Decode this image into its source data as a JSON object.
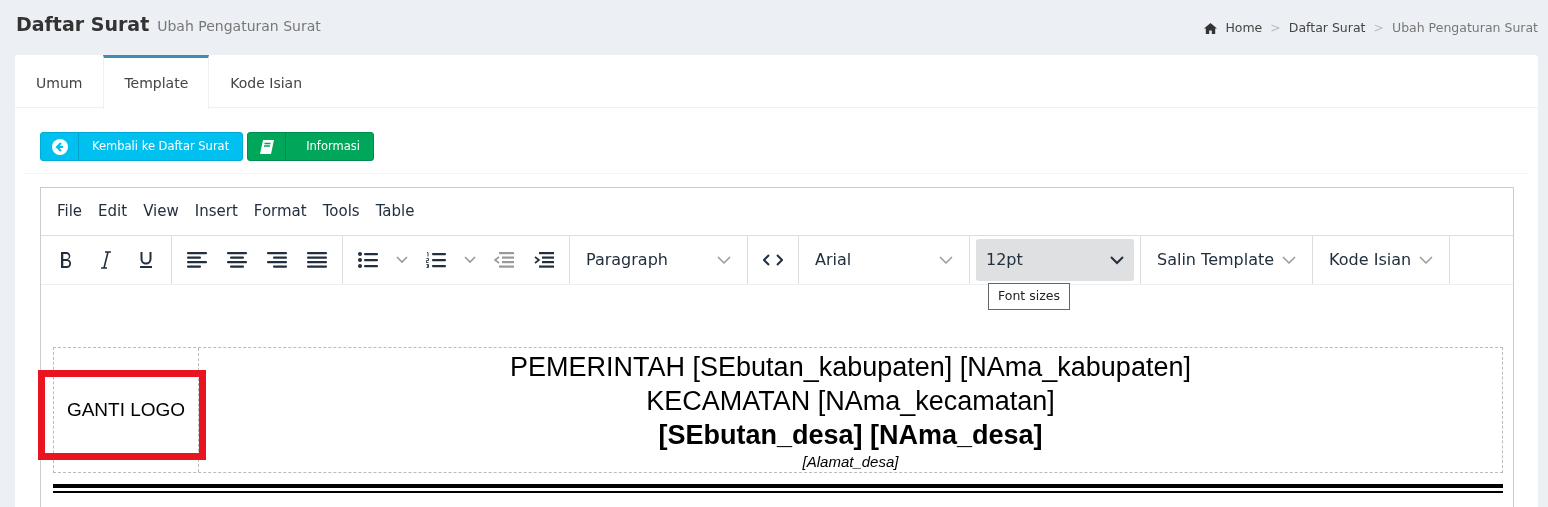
{
  "header": {
    "title": "Daftar Surat",
    "subtitle": "Ubah Pengaturan Surat"
  },
  "breadcrumb": [
    {
      "label": "Home",
      "kind": "home"
    },
    {
      "label": "Daftar Surat",
      "kind": "link",
      "separator": ">"
    },
    {
      "label": "Ubah Pengaturan Surat",
      "kind": "current",
      "separator": ">"
    }
  ],
  "tabs": [
    {
      "label": "Umum",
      "selected": false
    },
    {
      "label": "Template",
      "selected": true
    },
    {
      "label": "Kode Isian",
      "selected": false
    }
  ],
  "buttons": [
    {
      "label": "Kembali ke Daftar Surat",
      "kind": "back"
    },
    {
      "label": "Informasi",
      "kind": "info"
    }
  ],
  "editor": {
    "menu": [
      "File",
      "Edit",
      "View",
      "Insert",
      "Format",
      "Tools",
      "Table"
    ],
    "toolbar": [
      {
        "kind": "icons",
        "items": [
          {
            "kind": "bold"
          },
          {
            "kind": "italic"
          },
          {
            "kind": "underline"
          }
        ]
      },
      {
        "kind": "icons",
        "items": [
          {
            "kind": "align-left"
          },
          {
            "kind": "align-center"
          },
          {
            "kind": "align-right"
          },
          {
            "kind": "justify"
          }
        ]
      },
      {
        "kind": "icons",
        "items": [
          {
            "kind": "bullet-list"
          },
          {
            "kind": "caret"
          },
          {
            "kind": "numbered-list"
          },
          {
            "kind": "caret"
          },
          {
            "kind": "outdent"
          },
          {
            "kind": "indent"
          }
        ]
      },
      {
        "kind": "select",
        "label": "Paragraph",
        "active": false
      },
      {
        "kind": "icons",
        "items": [
          {
            "kind": "code"
          }
        ]
      },
      {
        "kind": "select",
        "label": "Arial",
        "active": false
      },
      {
        "kind": "select",
        "label": "12pt",
        "active": true,
        "tooltip": "Font sizes"
      },
      {
        "kind": "menu",
        "label": "Salin Template"
      },
      {
        "kind": "menu",
        "label": "Kode Isian"
      }
    ],
    "letterhead": {
      "logo": "GANTI LOGO",
      "logo_highlighted": true,
      "lines": [
        {
          "text": "PEMERINTAH [SEbutan_kabupaten] [NAma_kabupaten]",
          "kind": "large"
        },
        {
          "text": "KECAMATAN [NAma_kecamatan]",
          "kind": "large"
        },
        {
          "text": "[SEbutan_desa] [NAma_desa]",
          "kind": "bold"
        },
        {
          "text": "[Alamat_desa]",
          "kind": "italic"
        }
      ]
    }
  }
}
